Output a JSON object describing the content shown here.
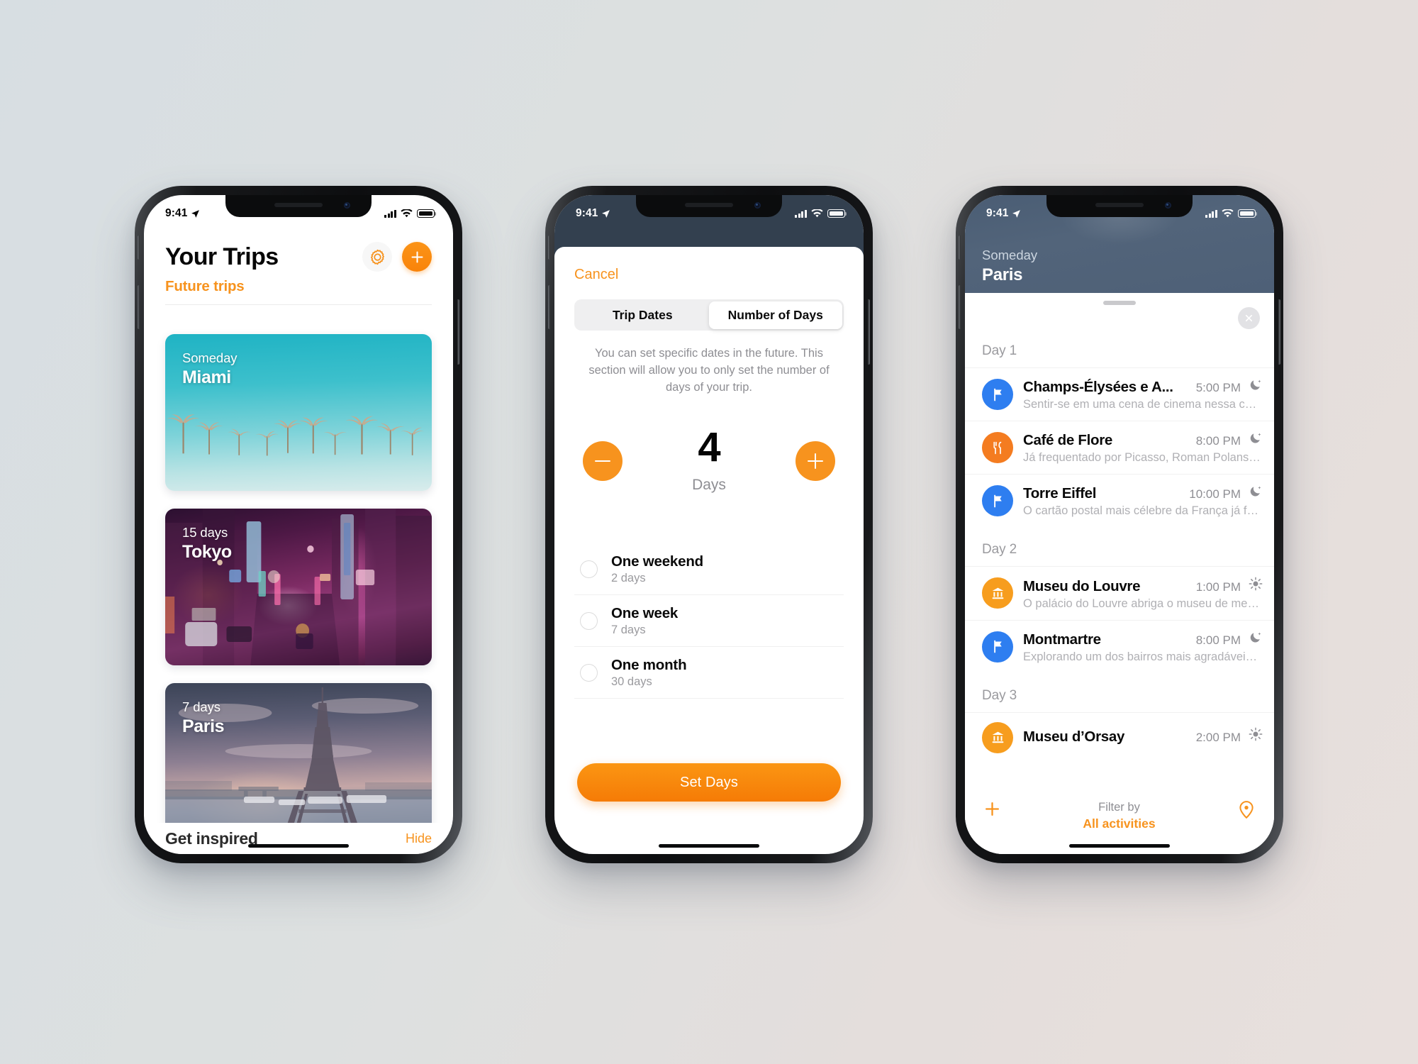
{
  "canvas": {
    "bg_from": "#d7dee2",
    "bg_to": "#e8e0dd"
  },
  "accent": "#f7931e",
  "status_bar": {
    "time": "9:41",
    "location_icon": "location-arrow-icon",
    "signal_icon": "cellular-bars-icon",
    "wifi_icon": "wifi-icon",
    "battery_icon": "battery-icon"
  },
  "phone1": {
    "title": "Your Trips",
    "settings_icon": "gear-icon",
    "add_icon": "plus-icon",
    "section_label": "Future trips",
    "trips": [
      {
        "duration": "Someday",
        "city": "Miami",
        "art": "miami-palms"
      },
      {
        "duration": "15 days",
        "city": "Tokyo",
        "art": "tokyo-neon-street"
      },
      {
        "duration": "7 days",
        "city": "Paris",
        "art": "paris-eiffel-tower"
      }
    ],
    "bottom": {
      "left_label": "Get inspired",
      "right_label": "Hide"
    }
  },
  "phone2": {
    "cancel_label": "Cancel",
    "segments": [
      {
        "label": "Trip Dates",
        "selected": false
      },
      {
        "label": "Number of Days",
        "selected": true
      }
    ],
    "description": "You can set specific dates in the future. This section will allow you to only set the number of days of your trip.",
    "stepper": {
      "decrement_icon": "minus-icon",
      "increment_icon": "plus-icon",
      "value": "4",
      "unit": "Days"
    },
    "options": [
      {
        "title": "One weekend",
        "subtitle": "2 days",
        "selected": false
      },
      {
        "title": "One week",
        "subtitle": "7 days",
        "selected": false
      },
      {
        "title": "One month",
        "subtitle": "30 days",
        "selected": false
      }
    ],
    "primary_button": "Set Days"
  },
  "phone3": {
    "eyebrow": "Someday",
    "city": "Paris",
    "grabber": "sheet-grabber",
    "close_icon": "close-icon",
    "days": [
      {
        "label": "Day 1",
        "activities": [
          {
            "icon": "flag-icon",
            "icon_color": "#2e7ef0",
            "name": "Champs-Élysées e A...",
            "time": "5:00 PM",
            "when_icon": "moon-icon",
            "description": "Sentir-se em uma cena de cinema nessa cha..."
          },
          {
            "icon": "restaurant-icon",
            "icon_color": "#f47c20",
            "name": "Café de Flore",
            "time": "8:00 PM",
            "when_icon": "moon-icon",
            "description": "Já frequentado por Picasso, Roman Polanski,..."
          },
          {
            "icon": "flag-icon",
            "icon_color": "#2e7ef0",
            "name": "Torre Eiffel",
            "time": "10:00 PM",
            "when_icon": "moon-icon",
            "description": "O cartão postal mais célebre da França já foi..."
          }
        ]
      },
      {
        "label": "Day 2",
        "activities": [
          {
            "icon": "museum-icon",
            "icon_color": "#f79d1e",
            "name": "Museu do Louvre",
            "time": "1:00 PM",
            "when_icon": "sun-icon",
            "description": "O palácio do Louvre abriga o museu de mes..."
          },
          {
            "icon": "flag-icon",
            "icon_color": "#2e7ef0",
            "name": "Montmartre",
            "time": "8:00 PM",
            "when_icon": "moon-icon",
            "description": "Explorando um dos bairros mais agradáveis d..."
          }
        ]
      },
      {
        "label": "Day 3",
        "activities": [
          {
            "icon": "museum-icon",
            "icon_color": "#f79d1e",
            "name": "Museu d’Orsay",
            "time": "2:00 PM",
            "when_icon": "sun-icon",
            "description": ""
          }
        ]
      }
    ],
    "toolbar": {
      "add_icon": "plus-icon",
      "filter_label": "Filter by",
      "filter_value": "All activities",
      "map_icon": "map-pin-icon"
    }
  }
}
